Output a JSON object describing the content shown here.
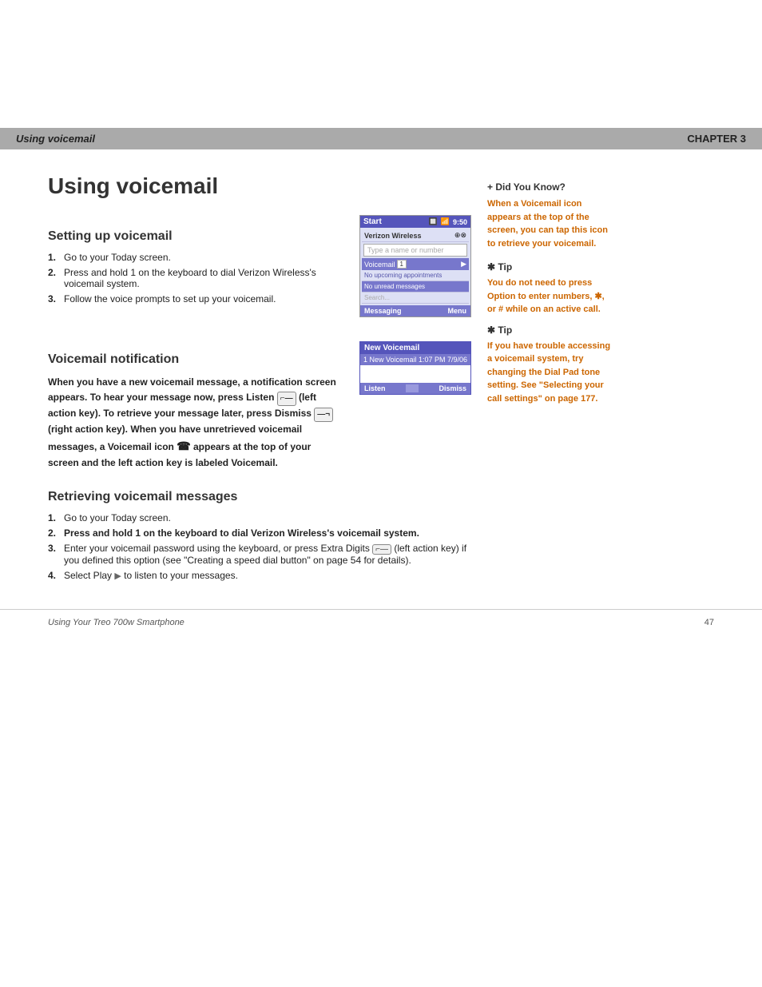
{
  "header": {
    "left_label": "Using voicemail",
    "right_label": "CHAPTER 3"
  },
  "page": {
    "title": "Using voicemail",
    "sections": {
      "setting_up": {
        "title": "Setting up voicemail",
        "steps": [
          "Go to your Today screen.",
          "Press and hold 1 on the keyboard to dial Verizon Wireless's voicemail system.",
          "Follow the voice prompts to set up your voicemail."
        ]
      },
      "notification": {
        "title": "Voicemail notification",
        "body": "When you have a new voicemail message, a notification screen appears. To hear your message now, press Listen",
        "body2": "(left action key). To retrieve your message later, press Dismiss",
        "body3": "(right action key). When you have unretrieved voicemail messages, a Voicemail icon",
        "body4": "appears at the top of your screen and the left action key is labeled Voicemail."
      },
      "retrieving": {
        "title": "Retrieving voicemail messages",
        "steps": [
          "Go to your Today screen.",
          "Press and hold 1 on the keyboard to dial Verizon Wireless's voicemail system.",
          "Enter your voicemail password using the keyboard, or press Extra Digits",
          "Select Play"
        ],
        "step3_cont": "(left action key) if you defined this option (see \"Creating a speed dial button\" on page 54 for details).",
        "step4_cont": "to listen to your messages."
      }
    }
  },
  "phone_screen": {
    "title_bar": "Start",
    "time": "9:50",
    "input_placeholder": "Type a name or number",
    "network": "Verizon Wireless",
    "voicemail_label": "Voicemail",
    "voicemail_count": "1",
    "appointment": "No upcoming appointments",
    "messages": "No unread messages",
    "search": "Search...",
    "footer_left": "Messaging",
    "footer_right": "Menu"
  },
  "popup": {
    "title": "New Voicemail",
    "row_text": "1 New Voicemail",
    "time": "1:07 PM  7/9/06",
    "btn_listen": "Listen",
    "btn_dismiss": "Dismiss"
  },
  "sidebar": {
    "did_you_know_title": "+ Did You Know?",
    "did_you_know_text": "When a Voicemail icon appears at the top of the screen, you can tap this icon to retrieve your voicemail.",
    "tip1_title": "✱ Tip",
    "tip1_text": "You do not need to press Option to enter numbers, ✱, or # while on an active call.",
    "tip2_title": "✱ Tip",
    "tip2_text": "If you have trouble accessing a voicemail system, try changing the Dial Pad tone setting. See \"Selecting your call settings\" on page 177."
  },
  "footer": {
    "left": "Using Your Treo 700w Smartphone",
    "right": "47"
  }
}
